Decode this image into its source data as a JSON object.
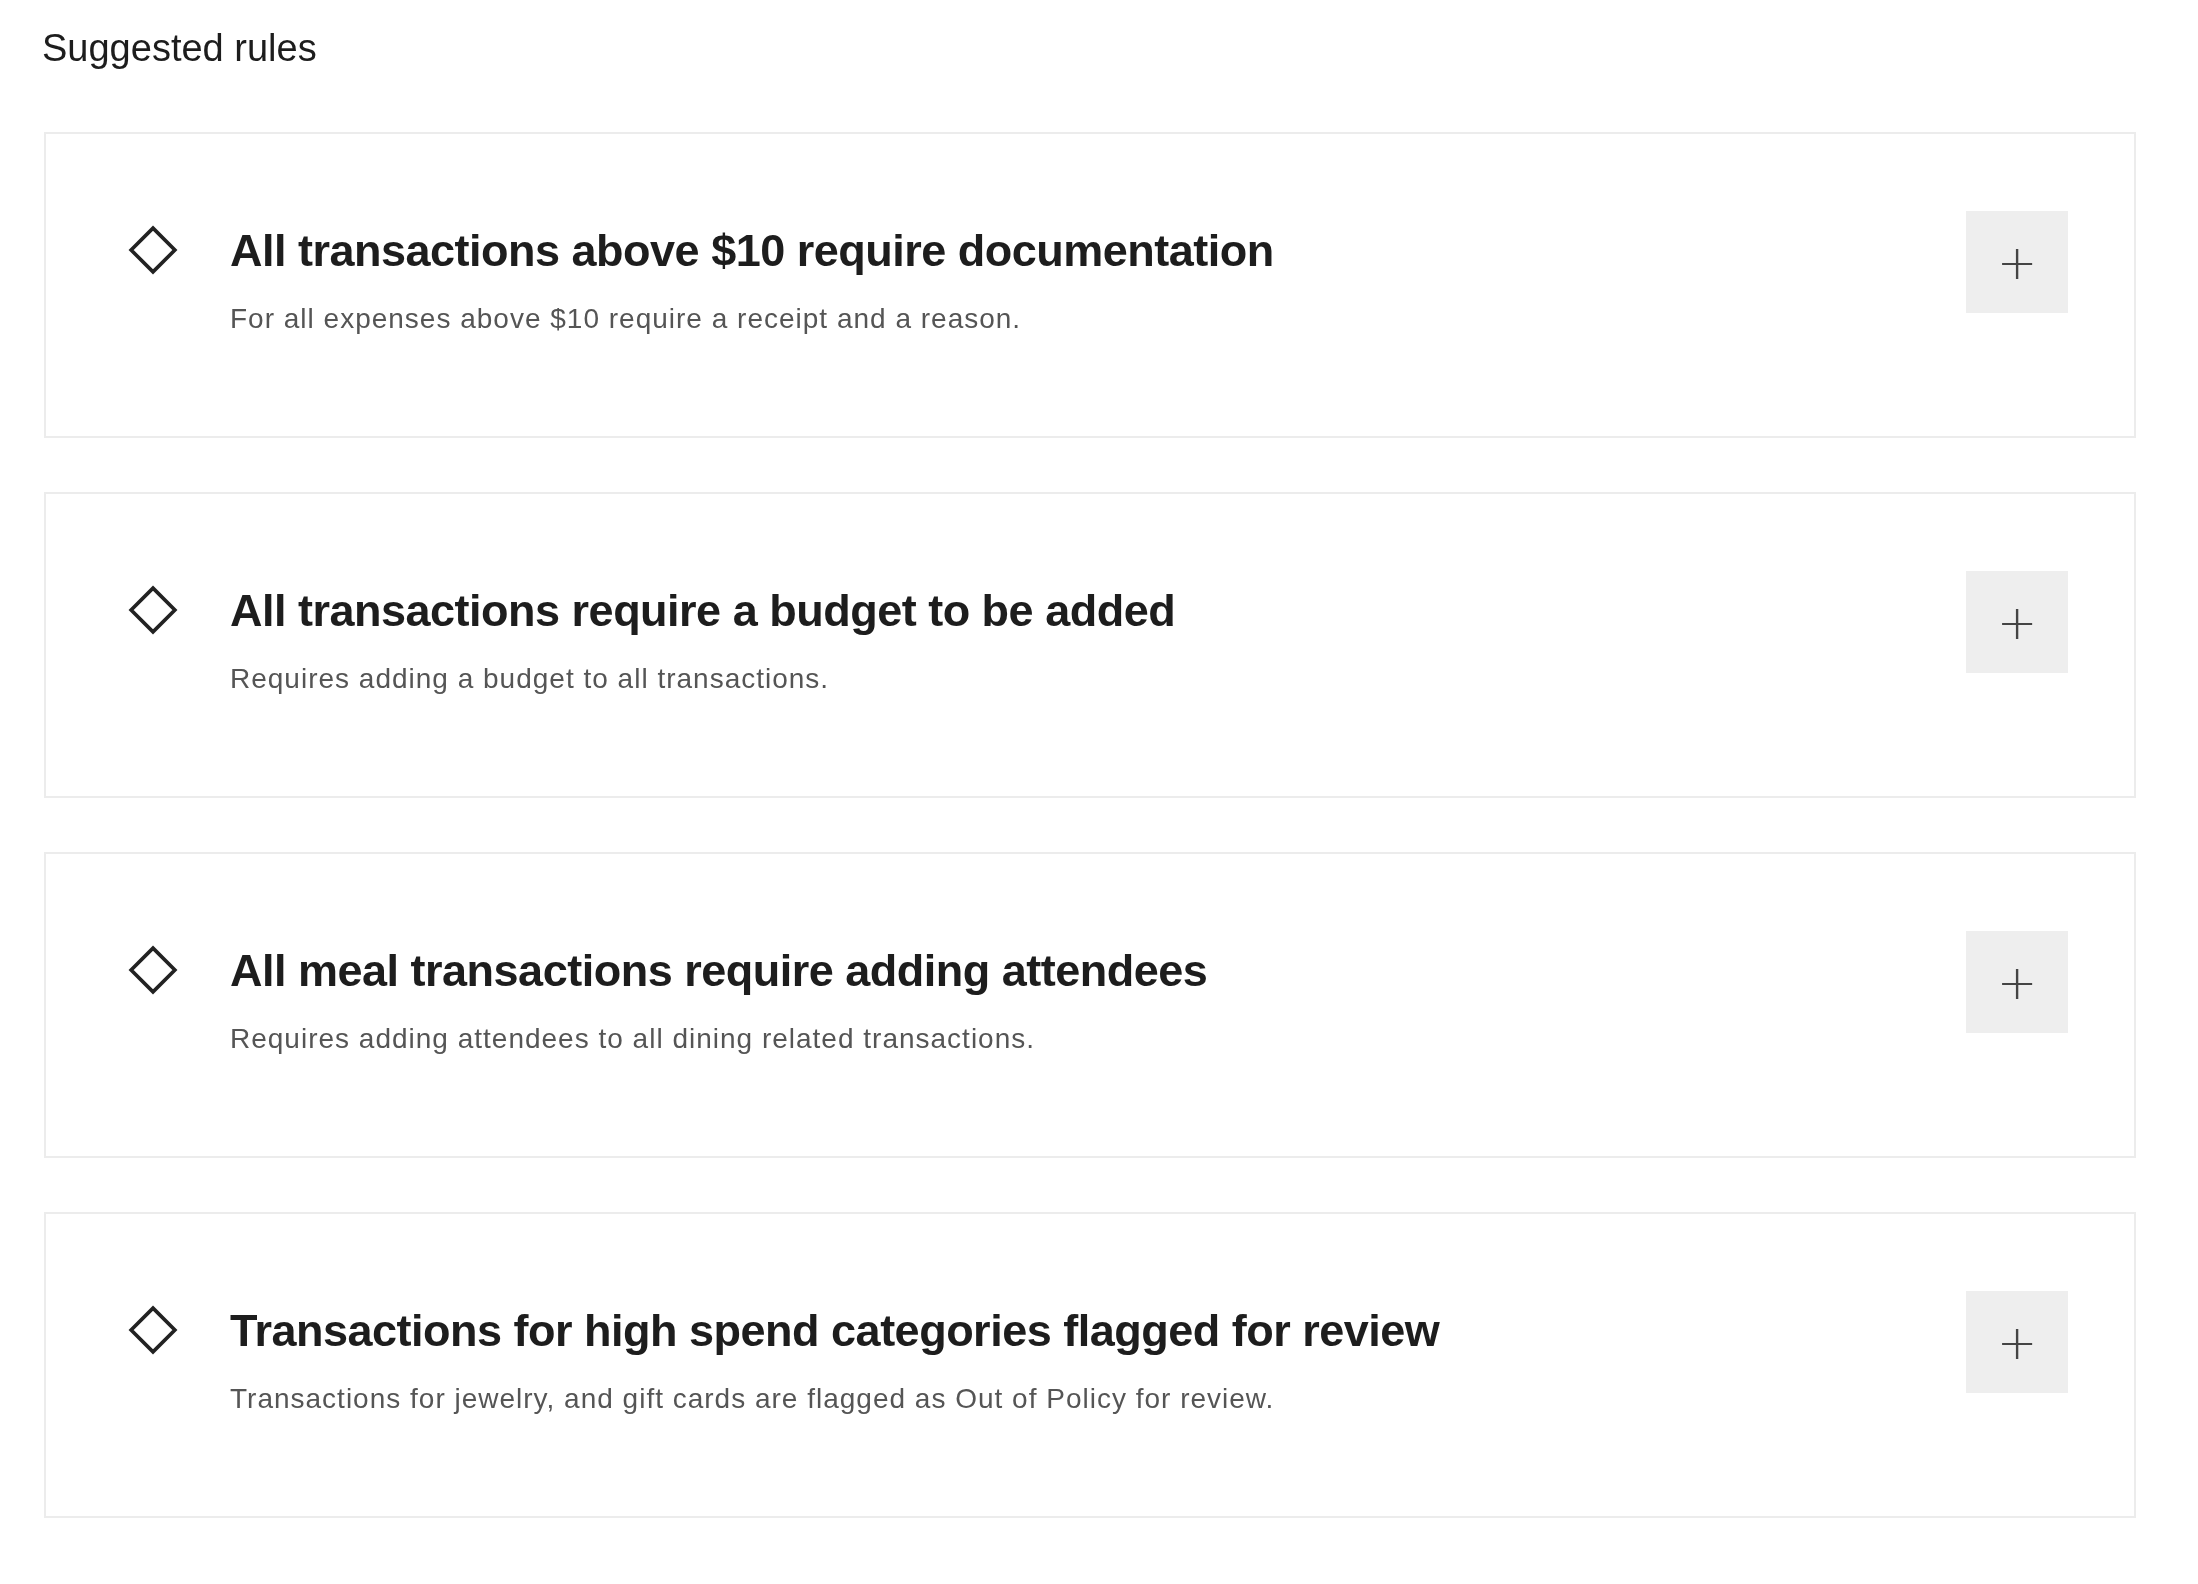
{
  "heading": "Suggested rules",
  "rules": [
    {
      "title": "All transactions above $10 require documentation",
      "description": "For all expenses above $10 require a receipt and a reason.",
      "action": "+"
    },
    {
      "title": "All transactions require a budget to be added",
      "description": "Requires adding a budget to all transactions.",
      "action": "+"
    },
    {
      "title": "All meal transactions require adding attendees",
      "description": "Requires adding attendees to all dining related transactions.",
      "action": "+"
    },
    {
      "title": "Transactions for high spend categories flagged for review",
      "description": "Transactions for jewelry, and gift cards are flagged as Out of Policy for review.",
      "action": "+"
    }
  ]
}
